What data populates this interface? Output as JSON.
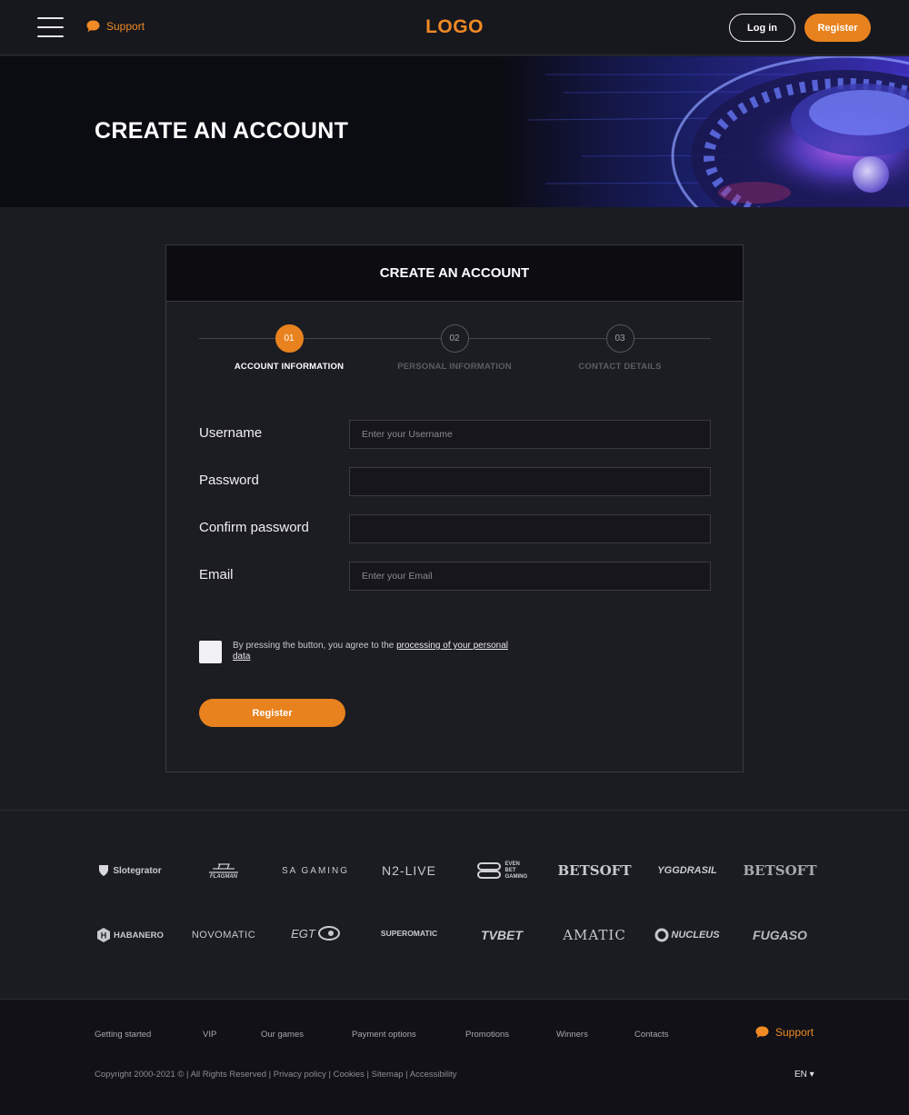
{
  "header": {
    "support_label": "Support",
    "logo_text": "LOGO",
    "login_label": "Log in",
    "register_label": "Register"
  },
  "hero": {
    "title": "CREATE AN ACCOUNT"
  },
  "form": {
    "title": "CREATE AN ACCOUNT",
    "steps": [
      {
        "number": "01",
        "label": "ACCOUNT INFORMATION",
        "active": true
      },
      {
        "number": "02",
        "label": "PERSONAL INFORMATION",
        "active": false
      },
      {
        "number": "03",
        "label": "CONTACT DETAILS",
        "active": false
      }
    ],
    "fields": [
      {
        "label": "Username",
        "value": "",
        "placeholder": "Enter your Username"
      },
      {
        "label": "Password",
        "value": "",
        "placeholder": ""
      },
      {
        "label": "Confirm password",
        "value": "",
        "placeholder": ""
      },
      {
        "label": "Email",
        "value": "",
        "placeholder": "Enter your Email"
      }
    ],
    "agree_text": "By pressing the button, you agree to the",
    "agree_link": "processing of your personal data",
    "submit_label": "Register"
  },
  "providers": [
    "Slotegrator",
    "FLAGMAN",
    "SA GAMING",
    "N2-LIVE",
    "EVEN BET GAMING",
    "BETSOFT",
    "YGGDRASIL",
    "BETSOFT",
    "HABANERO",
    "NOVOMATIC",
    "EGT",
    "SUPEROMATIC",
    "TVBET",
    "AMATIC",
    "NUCLEUS",
    "FUGASO"
  ],
  "footer": {
    "nav": [
      "Getting started",
      "VIP",
      "Our games",
      "Payment options",
      "Promotions",
      "Winners",
      "Contacts"
    ],
    "support_label": "Support",
    "copyright": "Copyright 2000-2021 © | All Rights Reserved |",
    "legal_links": [
      "Privacy policy",
      "Cookies",
      "Sitemap",
      "Accessibility"
    ],
    "language": "EN ▾"
  },
  "colors": {
    "accent": "#e8821e",
    "background": "#1b1b22",
    "header": "#17171e",
    "card_head": "#0c0c11"
  }
}
